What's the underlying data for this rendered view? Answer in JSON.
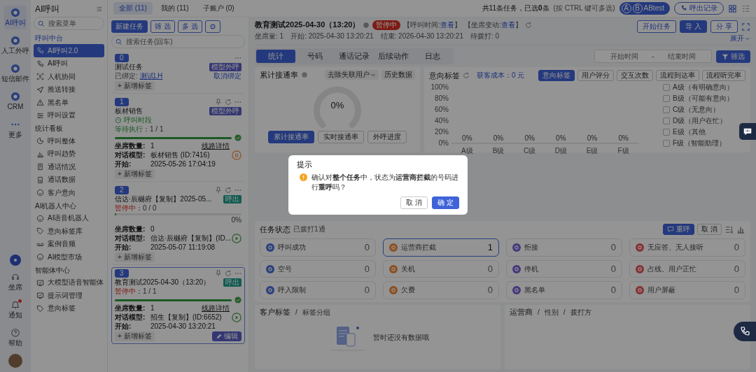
{
  "rail": {
    "items": [
      {
        "label": "AI呼叫",
        "selected": true
      },
      {
        "label": "人工外呼",
        "selected": false
      },
      {
        "label": "短信邮件",
        "selected": false
      },
      {
        "label": "CRM",
        "selected": false
      },
      {
        "label": "更多",
        "selected": false
      }
    ],
    "bottom": [
      {
        "label": "坐席",
        "badge": false
      },
      {
        "label": "通知",
        "badge": true
      },
      {
        "label": "帮助",
        "badge": false
      }
    ]
  },
  "menu": {
    "title": "AI呼叫",
    "search_placeholder": "搜索菜单",
    "sections": [
      {
        "title": "呼叫中台",
        "items": [
          {
            "label": "AI呼叫2.0",
            "selected": true
          },
          {
            "label": "AI呼叫",
            "selected": false
          },
          {
            "label": "人机协同",
            "selected": false
          },
          {
            "label": "推送转接",
            "selected": false
          },
          {
            "label": "黑名单",
            "selected": false
          },
          {
            "label": "呼叫设置",
            "selected": false
          }
        ]
      },
      {
        "title": "统计看板",
        "items": [
          {
            "label": "呼叫整体",
            "selected": false
          },
          {
            "label": "呼叫趋势",
            "selected": false
          },
          {
            "label": "通话情况",
            "selected": false
          },
          {
            "label": "通话数据",
            "selected": false
          },
          {
            "label": "客户意向",
            "selected": false
          }
        ]
      },
      {
        "title": "AI机器人中心",
        "items": [
          {
            "label": "AI语音机器人",
            "selected": false
          },
          {
            "label": "意向标签库",
            "selected": false
          },
          {
            "label": "案例音频",
            "selected": false
          },
          {
            "label": "AI模型市场",
            "selected": false
          }
        ]
      },
      {
        "title": "智能体中心",
        "items": [
          {
            "label": "大模型语音智能体",
            "selected": false
          },
          {
            "label": "提示词管理",
            "selected": false
          },
          {
            "label": "意向标签",
            "selected": false
          }
        ]
      }
    ]
  },
  "topbar": {
    "tabs": [
      {
        "label": "全部",
        "count": "(11)",
        "selected": true
      },
      {
        "label": "我的",
        "count": "(11)",
        "selected": false
      },
      {
        "label": "子账户",
        "count": "(0)",
        "selected": false
      }
    ],
    "summary": "共11条任务，已选",
    "selected_count": "0",
    "summary_end": "条",
    "hint": "(按 CTRL 键可多选)",
    "ab_letters": [
      "A",
      "B"
    ],
    "ab_label": "ABtest",
    "records_button": "呼出记录"
  },
  "task_panel": {
    "buttons": [
      {
        "label": "新建任务",
        "primary": true
      },
      {
        "label": "筛 选",
        "primary": false
      },
      {
        "label": "多 选",
        "primary": false
      }
    ],
    "search_placeholder": "搜索任务(回车)",
    "tasks": [
      {
        "kind": "bound",
        "index": "0",
        "selected": false,
        "title": "测试任务",
        "tag": {
          "text": "模型外呼",
          "color": "#353773"
        },
        "bound_label": "已绑定:",
        "bound_link": "测试LH",
        "unbind": "取消绑定",
        "add_tag": "+ 新增标签"
      },
      {
        "kind": "task",
        "index": "1",
        "selected": false,
        "title": "板材销售",
        "tag": {
          "text": "模型外呼",
          "color": "#353773"
        },
        "schedule": "呼叫时段",
        "status": {
          "kind": "waiting",
          "label": "等待执行",
          "count": "：1 / 1"
        },
        "level": 1,
        "control": {
          "kind": "pause"
        },
        "rows": [
          {
            "label": "坐席数量:",
            "value": "1",
            "link": "线路详情"
          },
          {
            "label": "对话模型:",
            "value": "板材销售 (ID:7416)"
          },
          {
            "label": "开始:",
            "value": "2025-05-26 17:04:19"
          }
        ],
        "add_tag": "+ 新增标签"
      },
      {
        "kind": "task",
        "index": "2",
        "selected": false,
        "title": "信达·辰樾府【复制】2025-05...",
        "tag": {
          "text": "呼出",
          "color": "#125c52"
        },
        "status": {
          "kind": "paused",
          "label": "暂停中",
          "count": "：0 / 0"
        },
        "level": 0,
        "percent": "0%",
        "control": {
          "kind": "play"
        },
        "rows": [
          {
            "label": "坐席数量:",
            "value": "0"
          },
          {
            "label": "对话模型:",
            "value": "信达·辰樾府【复制】(ID..."
          },
          {
            "label": "开始:",
            "value": "2025-05-07 11:19:08"
          }
        ],
        "add_tag": "+ 新增标签"
      },
      {
        "kind": "task",
        "index": "3",
        "selected": true,
        "title": "教育测试2025-04-30（13:20）",
        "tag": {
          "text": "呼出",
          "color": "#125c52"
        },
        "status": {
          "kind": "paused",
          "label": "暂停中",
          "count": "：1 / 1"
        },
        "level": 1,
        "control": {
          "kind": "play"
        },
        "rows": [
          {
            "label": "坐席数量:",
            "value": "1",
            "link": "线路详情"
          },
          {
            "label": "对话模型:",
            "value": "招生【复制】(ID:6652)"
          },
          {
            "label": "开始:",
            "value": "2025-04-30 13:20:21"
          }
        ],
        "add_tag": "+ 新增标签",
        "edit": "编辑"
      }
    ]
  },
  "detail": {
    "title": "教育测试2025-04-30（13:20）",
    "status": "暂停中",
    "links": [
      {
        "label": "【呼叫时间:",
        "link": "查看",
        "end": "】"
      },
      {
        "label": "【坐席变动:",
        "link": "查看",
        "end": "】"
      }
    ],
    "meta": [
      "坐席量: 1",
      "开始: 2025-04-30 13:20:21",
      "结束: 2026-04-30 13:20:21",
      "待拨打: 0"
    ],
    "actions": [
      {
        "label": "开始任务",
        "primary": false
      },
      {
        "label": "导 入",
        "primary": true
      },
      {
        "label": "分 享",
        "primary": false
      }
    ],
    "expand": "展开"
  },
  "tabs": [
    {
      "label": "统计",
      "selected": true
    },
    {
      "label": "号码",
      "selected": false
    },
    {
      "label": "通话记录",
      "selected": false
    },
    {
      "label": "后续动作",
      "selected": false
    },
    {
      "label": "日志",
      "selected": false
    }
  ],
  "date_range": {
    "start_placeholder": "开始时间",
    "separator": "-",
    "end_placeholder": "结束时间"
  },
  "filter_button": "筛选",
  "connect_card": {
    "title": "累计接通率",
    "dropdown": "去除失联用户",
    "history_button": "历史数据",
    "gauge": {
      "reading": "0%"
    },
    "modes": [
      {
        "label": "累计接通率",
        "selected": true
      },
      {
        "label": "实时接通率",
        "selected": false
      },
      {
        "label": "外呼进度",
        "selected": false
      }
    ]
  },
  "intent_card": {
    "title": "意向标签",
    "cost": "获客成本：0 元",
    "tabs": [
      {
        "label": "意向标签",
        "selected": true
      },
      {
        "label": "用户评分",
        "selected": false
      },
      {
        "label": "交互次数",
        "selected": false
      },
      {
        "label": "流程到达率",
        "selected": false
      },
      {
        "label": "流程听完率",
        "selected": false
      }
    ],
    "chart_data": {
      "type": "bar",
      "categories": [
        "A级",
        "B级",
        "C级",
        "D级",
        "E级",
        "F级"
      ],
      "values": [
        0,
        0,
        0,
        0,
        0,
        0
      ],
      "ylim": [
        0,
        100
      ],
      "yticks": [
        {
          "value": 0,
          "label": "0%"
        },
        {
          "value": 20,
          "label": "20%"
        },
        {
          "value": 40,
          "label": "40%"
        },
        {
          "value": 60,
          "label": "60%"
        },
        {
          "value": 80,
          "label": "80%"
        },
        {
          "value": 100,
          "label": "100%"
        }
      ],
      "value_labels": [
        "0%",
        "0%",
        "0%",
        "0%",
        "0%",
        "0%"
      ]
    },
    "legend": [
      {
        "label": "A级（有明确意向）",
        "checked": false
      },
      {
        "label": "B级（可能有意向）",
        "checked": false
      },
      {
        "label": "C级（无意向）",
        "checked": false
      },
      {
        "label": "D级（用户在忙）",
        "checked": false
      },
      {
        "label": "E级（其他",
        "checked": false
      },
      {
        "label": "F级（智能助理）",
        "checked": false
      }
    ]
  },
  "status_card": {
    "title": "任务状态",
    "subtitle": "已拨打1通",
    "recall_button": "重呼",
    "cancel_button": "取 消",
    "tiles": [
      {
        "label": "呼叫成功",
        "count": "0",
        "color": "#2b407c",
        "selected": false
      },
      {
        "label": "运营商拦截",
        "count": "1",
        "color": "#8b5023",
        "selected": true
      },
      {
        "label": "拒接",
        "count": "0",
        "color": "#47387c",
        "selected": false
      },
      {
        "label": "无应答、无人接听",
        "count": "0",
        "color": "#873234",
        "selected": false
      },
      {
        "label": "空号",
        "count": "0",
        "color": "#2b407c",
        "selected": false
      },
      {
        "label": "关机",
        "count": "0",
        "color": "#8b5023",
        "selected": false
      },
      {
        "label": "停机",
        "count": "0",
        "color": "#47387c",
        "selected": false
      },
      {
        "label": "占线、用户正忙",
        "count": "0",
        "color": "#873234",
        "selected": false
      },
      {
        "label": "呼入限制",
        "count": "0",
        "color": "#2b407c",
        "selected": false
      },
      {
        "label": "欠费",
        "count": "0",
        "color": "#8b5023",
        "selected": false
      },
      {
        "label": "黑名单",
        "count": "0",
        "color": "#47387c",
        "selected": false
      },
      {
        "label": "用户屏蔽",
        "count": "0",
        "color": "#873234",
        "selected": false
      }
    ]
  },
  "customer_tags": {
    "title": "客户标签",
    "crumbs": [
      {
        "separator": "/",
        "label": "标签分组"
      }
    ],
    "empty": "暂时还没有数据哦"
  },
  "carrier": {
    "title": "运营商",
    "crumbs": [
      {
        "separator": "/",
        "label": "性别"
      },
      {
        "separator": "/",
        "label": "拨打方"
      }
    ]
  },
  "dialog": {
    "title": "提示",
    "message": "确认对**整个任务**中，状态为**运营商拦截**的号码进行**重呼**吗？",
    "buttons": [
      {
        "label": "取 消",
        "primary": false
      },
      {
        "label": "确 定",
        "primary": true
      }
    ]
  }
}
